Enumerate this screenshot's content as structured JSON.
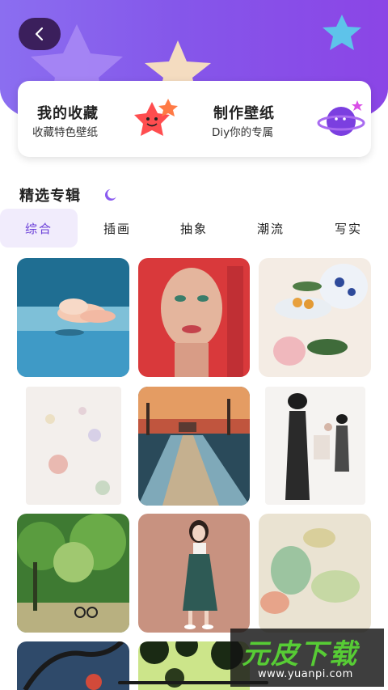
{
  "header": {
    "back_icon": "chevron-left-icon",
    "colors": {
      "gradient_start": "#8b6ef0",
      "gradient_end": "#8b45e6"
    }
  },
  "cards": [
    {
      "title": "我的收藏",
      "subtitle": "收藏特色壁纸",
      "icon": "star-face-icon"
    },
    {
      "title": "制作壁纸",
      "subtitle": "Diy你的专属",
      "icon": "planet-icon"
    }
  ],
  "section": {
    "title": "精选专辑",
    "icon": "crescent-icon"
  },
  "tabs": [
    {
      "label": "综合",
      "active": true
    },
    {
      "label": "插画",
      "active": false
    },
    {
      "label": "抽象",
      "active": false
    },
    {
      "label": "潮流",
      "active": false
    },
    {
      "label": "写实",
      "active": false
    }
  ],
  "wallpapers": [
    "sky-whale-illustration",
    "red-portrait-painting",
    "porcelain-floral-still-life",
    "abstract-watercolor-texture",
    "snowy-road-painting",
    "ink-figures-sketch",
    "green-forest-bicycle",
    "girl-green-dress-illustration",
    "abstract-green-wash",
    "tree-branch-illustration",
    "foliage-silhouette-illustration"
  ],
  "watermark": {
    "title": "元皮下载",
    "url": "www.yuanpi.com"
  },
  "accent_color": "#6b3fd8"
}
